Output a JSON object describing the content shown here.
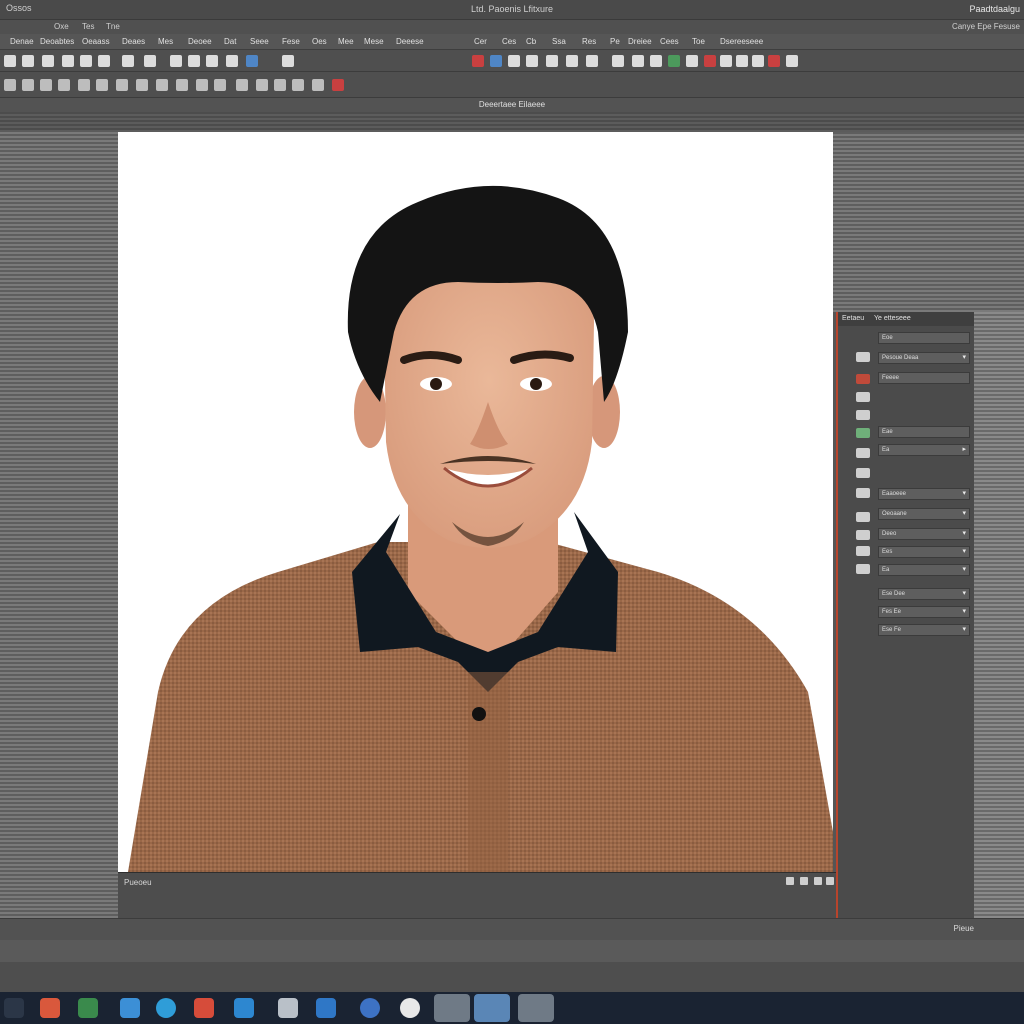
{
  "window": {
    "left_label": "Ossos",
    "title": "Ltd. Paoenis Lfitxure",
    "right_label": "Paadtdaalgu"
  },
  "menubar": {
    "items": [
      "Oxe",
      "Tes",
      "Tne"
    ],
    "right_label": "Canye Epe Fesuse"
  },
  "tabbar": {
    "tabs": [
      "Denae",
      "Deoabtes",
      "Oeaass",
      "Deaes",
      "Mes",
      "Deoee",
      "Dat",
      "Seee",
      "Fese",
      "Oes",
      "Mee",
      "Mese",
      "Deeese",
      "Cer",
      "Ces",
      "Cb",
      "Ssa",
      "Res",
      "Pe",
      "Dreiee",
      "Cees",
      "Toe",
      "Dsereeseee"
    ]
  },
  "document": {
    "tab_label": "Deeertaee   Eilaeee"
  },
  "canvas": {
    "image_subject": "portrait-photo"
  },
  "statusbar": {
    "text": "Pueoeu"
  },
  "panel": {
    "header_tabs": [
      "Eetaeu",
      "Ye etteseee"
    ],
    "rows": [
      "Eoe",
      "Pesoue Deaa",
      "Feeee",
      "Eae",
      "Ea",
      "Eaaoeee",
      "Oeoaane",
      "Deeo",
      "Ees",
      "Ea",
      "Ese  Dee",
      "Fes  Ee",
      "Ese  Fe"
    ]
  },
  "bottombar": {
    "text": "Pieue"
  },
  "colors": {
    "accent": "#b8442c",
    "canvas_bg": "#ffffff",
    "taskbar_bg": "#1a2332"
  }
}
